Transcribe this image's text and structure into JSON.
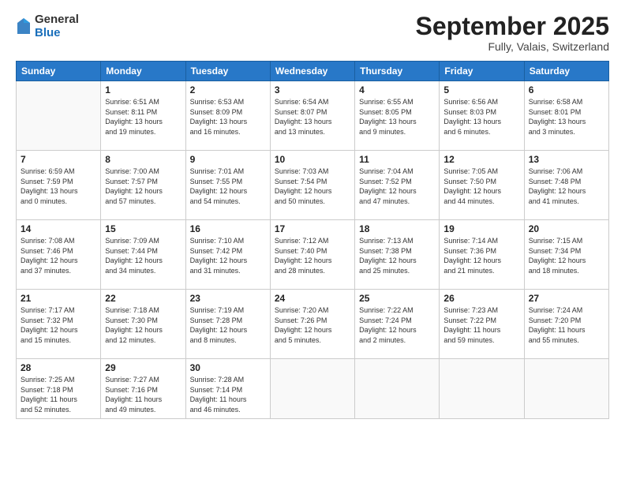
{
  "logo": {
    "general": "General",
    "blue": "Blue"
  },
  "header": {
    "month": "September 2025",
    "location": "Fully, Valais, Switzerland"
  },
  "days_of_week": [
    "Sunday",
    "Monday",
    "Tuesday",
    "Wednesday",
    "Thursday",
    "Friday",
    "Saturday"
  ],
  "weeks": [
    [
      {
        "day": "",
        "info": ""
      },
      {
        "day": "1",
        "info": "Sunrise: 6:51 AM\nSunset: 8:11 PM\nDaylight: 13 hours\nand 19 minutes."
      },
      {
        "day": "2",
        "info": "Sunrise: 6:53 AM\nSunset: 8:09 PM\nDaylight: 13 hours\nand 16 minutes."
      },
      {
        "day": "3",
        "info": "Sunrise: 6:54 AM\nSunset: 8:07 PM\nDaylight: 13 hours\nand 13 minutes."
      },
      {
        "day": "4",
        "info": "Sunrise: 6:55 AM\nSunset: 8:05 PM\nDaylight: 13 hours\nand 9 minutes."
      },
      {
        "day": "5",
        "info": "Sunrise: 6:56 AM\nSunset: 8:03 PM\nDaylight: 13 hours\nand 6 minutes."
      },
      {
        "day": "6",
        "info": "Sunrise: 6:58 AM\nSunset: 8:01 PM\nDaylight: 13 hours\nand 3 minutes."
      }
    ],
    [
      {
        "day": "7",
        "info": "Sunrise: 6:59 AM\nSunset: 7:59 PM\nDaylight: 13 hours\nand 0 minutes."
      },
      {
        "day": "8",
        "info": "Sunrise: 7:00 AM\nSunset: 7:57 PM\nDaylight: 12 hours\nand 57 minutes."
      },
      {
        "day": "9",
        "info": "Sunrise: 7:01 AM\nSunset: 7:55 PM\nDaylight: 12 hours\nand 54 minutes."
      },
      {
        "day": "10",
        "info": "Sunrise: 7:03 AM\nSunset: 7:54 PM\nDaylight: 12 hours\nand 50 minutes."
      },
      {
        "day": "11",
        "info": "Sunrise: 7:04 AM\nSunset: 7:52 PM\nDaylight: 12 hours\nand 47 minutes."
      },
      {
        "day": "12",
        "info": "Sunrise: 7:05 AM\nSunset: 7:50 PM\nDaylight: 12 hours\nand 44 minutes."
      },
      {
        "day": "13",
        "info": "Sunrise: 7:06 AM\nSunset: 7:48 PM\nDaylight: 12 hours\nand 41 minutes."
      }
    ],
    [
      {
        "day": "14",
        "info": "Sunrise: 7:08 AM\nSunset: 7:46 PM\nDaylight: 12 hours\nand 37 minutes."
      },
      {
        "day": "15",
        "info": "Sunrise: 7:09 AM\nSunset: 7:44 PM\nDaylight: 12 hours\nand 34 minutes."
      },
      {
        "day": "16",
        "info": "Sunrise: 7:10 AM\nSunset: 7:42 PM\nDaylight: 12 hours\nand 31 minutes."
      },
      {
        "day": "17",
        "info": "Sunrise: 7:12 AM\nSunset: 7:40 PM\nDaylight: 12 hours\nand 28 minutes."
      },
      {
        "day": "18",
        "info": "Sunrise: 7:13 AM\nSunset: 7:38 PM\nDaylight: 12 hours\nand 25 minutes."
      },
      {
        "day": "19",
        "info": "Sunrise: 7:14 AM\nSunset: 7:36 PM\nDaylight: 12 hours\nand 21 minutes."
      },
      {
        "day": "20",
        "info": "Sunrise: 7:15 AM\nSunset: 7:34 PM\nDaylight: 12 hours\nand 18 minutes."
      }
    ],
    [
      {
        "day": "21",
        "info": "Sunrise: 7:17 AM\nSunset: 7:32 PM\nDaylight: 12 hours\nand 15 minutes."
      },
      {
        "day": "22",
        "info": "Sunrise: 7:18 AM\nSunset: 7:30 PM\nDaylight: 12 hours\nand 12 minutes."
      },
      {
        "day": "23",
        "info": "Sunrise: 7:19 AM\nSunset: 7:28 PM\nDaylight: 12 hours\nand 8 minutes."
      },
      {
        "day": "24",
        "info": "Sunrise: 7:20 AM\nSunset: 7:26 PM\nDaylight: 12 hours\nand 5 minutes."
      },
      {
        "day": "25",
        "info": "Sunrise: 7:22 AM\nSunset: 7:24 PM\nDaylight: 12 hours\nand 2 minutes."
      },
      {
        "day": "26",
        "info": "Sunrise: 7:23 AM\nSunset: 7:22 PM\nDaylight: 11 hours\nand 59 minutes."
      },
      {
        "day": "27",
        "info": "Sunrise: 7:24 AM\nSunset: 7:20 PM\nDaylight: 11 hours\nand 55 minutes."
      }
    ],
    [
      {
        "day": "28",
        "info": "Sunrise: 7:25 AM\nSunset: 7:18 PM\nDaylight: 11 hours\nand 52 minutes."
      },
      {
        "day": "29",
        "info": "Sunrise: 7:27 AM\nSunset: 7:16 PM\nDaylight: 11 hours\nand 49 minutes."
      },
      {
        "day": "30",
        "info": "Sunrise: 7:28 AM\nSunset: 7:14 PM\nDaylight: 11 hours\nand 46 minutes."
      },
      {
        "day": "",
        "info": ""
      },
      {
        "day": "",
        "info": ""
      },
      {
        "day": "",
        "info": ""
      },
      {
        "day": "",
        "info": ""
      }
    ]
  ]
}
